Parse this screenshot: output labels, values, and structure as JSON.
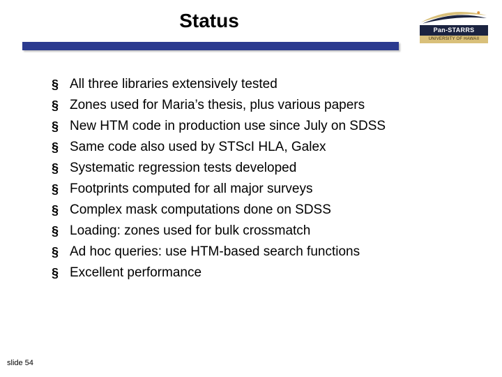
{
  "title": "Status",
  "logo": {
    "main": "Pan-STARRS",
    "sub": "UNIVERSITY OF HAWAII"
  },
  "bullets": [
    "All three libraries extensively tested",
    "Zones used for Maria’s thesis, plus various papers",
    "New HTM code in production use since July on SDSS",
    "Same code also used by STScI HLA, Galex",
    "Systematic regression tests developed",
    "Footprints computed for all major surveys",
    "Complex mask computations done on SDSS",
    "Loading: zones used for bulk crossmatch",
    "Ad hoc queries: use HTM-based search functions",
    "Excellent performance"
  ],
  "footer": "slide 54"
}
